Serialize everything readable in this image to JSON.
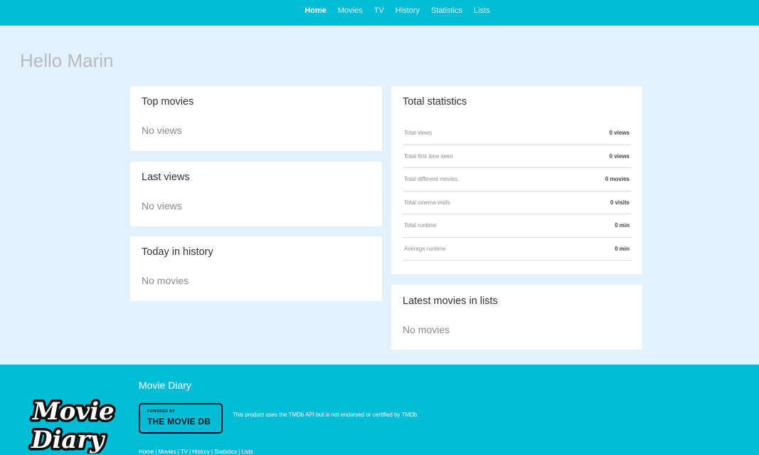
{
  "nav": {
    "items": [
      {
        "label": "Home",
        "active": true
      },
      {
        "label": "Movies",
        "active": false
      },
      {
        "label": "TV",
        "active": false
      },
      {
        "label": "History",
        "active": false
      },
      {
        "label": "Statistics",
        "active": false
      },
      {
        "label": "Lists",
        "active": false
      }
    ]
  },
  "greeting": "Hello Marin",
  "cards": {
    "top_movies": {
      "title": "Top movies",
      "empty": "No views"
    },
    "last_views": {
      "title": "Last views",
      "empty": "No views"
    },
    "today_history": {
      "title": "Today in history",
      "empty": "No movies"
    },
    "latest_lists": {
      "title": "Latest movies in lists",
      "empty": "No movies"
    }
  },
  "stats": {
    "title": "Total statistics",
    "rows": [
      {
        "label": "Total views",
        "value": "0 views"
      },
      {
        "label": "Total first time seen",
        "value": "0 views"
      },
      {
        "label": "Total different movies",
        "value": "0 movies"
      },
      {
        "label": "Total cinema visits",
        "value": "0 visits"
      },
      {
        "label": "Total runtime",
        "value": "0 min"
      },
      {
        "label": "Average runtime",
        "value": "0 min"
      }
    ]
  },
  "footer": {
    "brand": "Movie Diary",
    "logo_text_line1": "Movie",
    "logo_text_line2": "Diary",
    "tmdb_small": "POWERED BY",
    "tmdb_big": "THE MOVIE DB",
    "tmdb_note": "This product uses the TMDb API but is not endorsed or certified by TMDb.",
    "links": [
      "Home",
      "Movies",
      "TV",
      "History",
      "Statistics",
      "Lists"
    ],
    "separator": "|"
  },
  "colors": {
    "primary": "#00bcd4",
    "background": "#e3f1fc",
    "card": "#ffffff"
  }
}
